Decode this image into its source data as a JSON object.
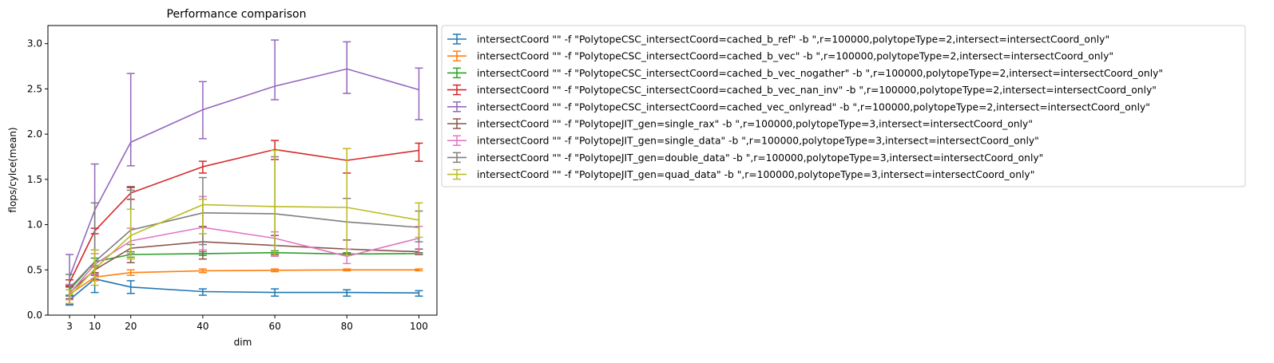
{
  "chart_data": {
    "type": "line",
    "title": "Performance comparison",
    "xlabel": "dim",
    "ylabel": "flops/cylce(mean)",
    "x": [
      3,
      10,
      20,
      40,
      60,
      80,
      100
    ],
    "xticks": [
      "3",
      "10",
      "20",
      "40",
      "60",
      "80",
      "100"
    ],
    "yticks": [
      "0.0",
      "0.5",
      "1.0",
      "1.5",
      "2.0",
      "2.5",
      "3.0"
    ],
    "xlim": [
      -3,
      105
    ],
    "ylim": [
      0,
      3.2
    ],
    "grid": false,
    "legend_position": "outside-right",
    "error_bars": true,
    "series": [
      {
        "name": "intersectCoord \"\" -f \"PolytopeCSC_intersectCoord=cached_b_ref\" -b \",r=100000,polytopeType=2,intersect=intersectCoord_only\"",
        "color": "#1f77b4",
        "values": [
          0.17,
          0.4,
          0.31,
          0.26,
          0.25,
          0.25,
          0.245
        ],
        "lower": [
          0.12,
          0.25,
          0.24,
          0.22,
          0.21,
          0.21,
          0.21
        ],
        "upper": [
          0.22,
          0.44,
          0.38,
          0.29,
          0.29,
          0.28,
          0.27
        ]
      },
      {
        "name": "intersectCoord \"\" -f \"PolytopeCSC_intersectCoord=cached_b_vec\" -b \",r=100000,polytopeType=2,intersect=intersectCoord_only\"",
        "color": "#ff7f0e",
        "values": [
          0.23,
          0.42,
          0.47,
          0.49,
          0.495,
          0.5,
          0.5
        ],
        "lower": [
          0.18,
          0.38,
          0.44,
          0.47,
          0.48,
          0.49,
          0.49
        ],
        "upper": [
          0.28,
          0.46,
          0.5,
          0.51,
          0.51,
          0.51,
          0.51
        ]
      },
      {
        "name": "intersectCoord \"\" -f \"PolytopeCSC_intersectCoord=cached_b_vec_nogather\" -b \",r=100000,polytopeType=2,intersect=intersectCoord_only\"",
        "color": "#2ca02c",
        "values": [
          0.28,
          0.59,
          0.67,
          0.68,
          0.69,
          0.675,
          0.68
        ],
        "lower": [
          0.22,
          0.55,
          0.64,
          0.66,
          0.67,
          0.66,
          0.67
        ],
        "upper": [
          0.33,
          0.63,
          0.7,
          0.7,
          0.71,
          0.69,
          0.69
        ]
      },
      {
        "name": "intersectCoord \"\" -f \"PolytopeCSC_intersectCoord=cached_b_vec_nan_inv\" -b \",r=100000,polytopeType=2,intersect=intersectCoord_only\"",
        "color": "#d62728",
        "values": [
          0.36,
          0.93,
          1.35,
          1.64,
          1.83,
          1.71,
          1.82
        ],
        "lower": [
          0.32,
          0.9,
          1.28,
          1.57,
          1.72,
          1.57,
          1.7
        ],
        "upper": [
          0.39,
          0.96,
          1.41,
          1.7,
          1.93,
          1.84,
          1.9
        ]
      },
      {
        "name": "intersectCoord \"\" -f \"PolytopeCSC_intersectCoord=cached_vec_onlyread\" -b \",r=100000,polytopeType=2,intersect=intersectCoord_only\"",
        "color": "#9467bd",
        "values": [
          0.42,
          1.16,
          1.91,
          2.27,
          2.53,
          2.72,
          2.49
        ],
        "lower": [
          0.21,
          0.72,
          1.65,
          1.95,
          2.38,
          2.45,
          2.16
        ],
        "upper": [
          0.67,
          1.67,
          2.67,
          2.58,
          3.04,
          3.02,
          2.73
        ]
      },
      {
        "name": "intersectCoord \"\" -f \"PolytopeJIT_gen=single_rax\" -b \",r=100000,polytopeType=3,intersect=intersectCoord_only\"",
        "color": "#8c564b",
        "values": [
          0.25,
          0.5,
          0.74,
          0.81,
          0.77,
          0.73,
          0.7
        ],
        "lower": [
          0.18,
          0.47,
          0.58,
          0.62,
          0.67,
          0.67,
          0.67
        ],
        "upper": [
          0.31,
          0.53,
          1.42,
          0.98,
          0.88,
          0.83,
          0.73
        ]
      },
      {
        "name": "intersectCoord \"\" -f \"PolytopeJIT_gen=single_data\" -b \",r=100000,polytopeType=3,intersect=intersectCoord_only\"",
        "color": "#e377c2",
        "values": [
          0.24,
          0.56,
          0.82,
          0.97,
          0.85,
          0.65,
          0.85
        ],
        "lower": [
          0.17,
          0.45,
          0.68,
          0.72,
          0.65,
          0.57,
          0.68
        ],
        "upper": [
          0.34,
          0.68,
          0.96,
          1.31,
          0.92,
          0.73,
          0.98
        ]
      },
      {
        "name": "intersectCoord \"\" -f \"PolytopeJIT_gen=double_data\" -b \",r=100000,polytopeType=3,intersect=intersectCoord_only\"",
        "color": "#7f7f7f",
        "values": [
          0.3,
          0.59,
          0.94,
          1.13,
          1.12,
          1.03,
          0.97
        ],
        "lower": [
          0.11,
          0.4,
          0.78,
          0.78,
          0.77,
          0.68,
          0.81
        ],
        "upper": [
          0.45,
          1.24,
          1.38,
          1.52,
          1.75,
          1.29,
          1.15
        ]
      },
      {
        "name": "intersectCoord \"\" -f \"PolytopeJIT_gen=quad_data\" -b \",r=100000,polytopeType=3,intersect=intersectCoord_only\"",
        "color": "#bcbd22",
        "values": [
          0.21,
          0.51,
          0.88,
          1.22,
          1.2,
          1.19,
          1.05
        ],
        "lower": [
          0.13,
          0.33,
          0.62,
          0.9,
          0.66,
          0.66,
          0.86
        ],
        "upper": [
          0.28,
          0.72,
          1.17,
          1.28,
          1.82,
          1.84,
          1.24
        ]
      }
    ]
  }
}
